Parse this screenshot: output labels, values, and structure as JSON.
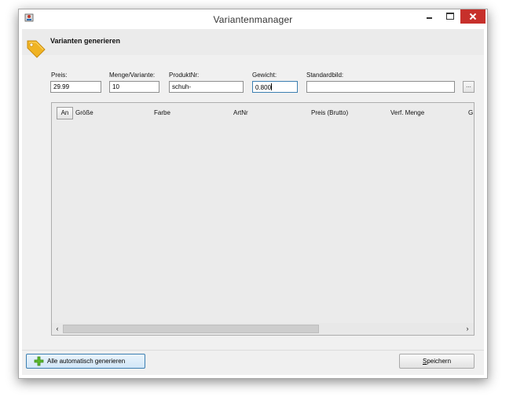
{
  "window": {
    "title": "Variantenmanager"
  },
  "header": {
    "title": "Varianten generieren",
    "icon": "tag-icon"
  },
  "form": {
    "preis_label": "Preis:",
    "preis_value": "29.99",
    "menge_label": "Menge/Variante:",
    "menge_value": "10",
    "produktnr_label": "ProduktNr:",
    "produktnr_value": "schuh-",
    "gewicht_label": "Gewicht:",
    "gewicht_value": "0.800",
    "standardbild_label": "Standardbild:",
    "standardbild_value": "",
    "browse_label": "..."
  },
  "table": {
    "an_button": "An",
    "columns": [
      "Größe",
      "Farbe",
      "ArtNr",
      "Preis (Brutto)",
      "Verf. Menge",
      "G"
    ],
    "rows": []
  },
  "footer": {
    "generate_label": "Alle automatisch generieren",
    "save_first": "S",
    "save_rest": "peichern"
  },
  "colors": {
    "close_button": "#c7302b",
    "focus_border": "#3c7fb1",
    "tag_icon": "#f0b323"
  }
}
